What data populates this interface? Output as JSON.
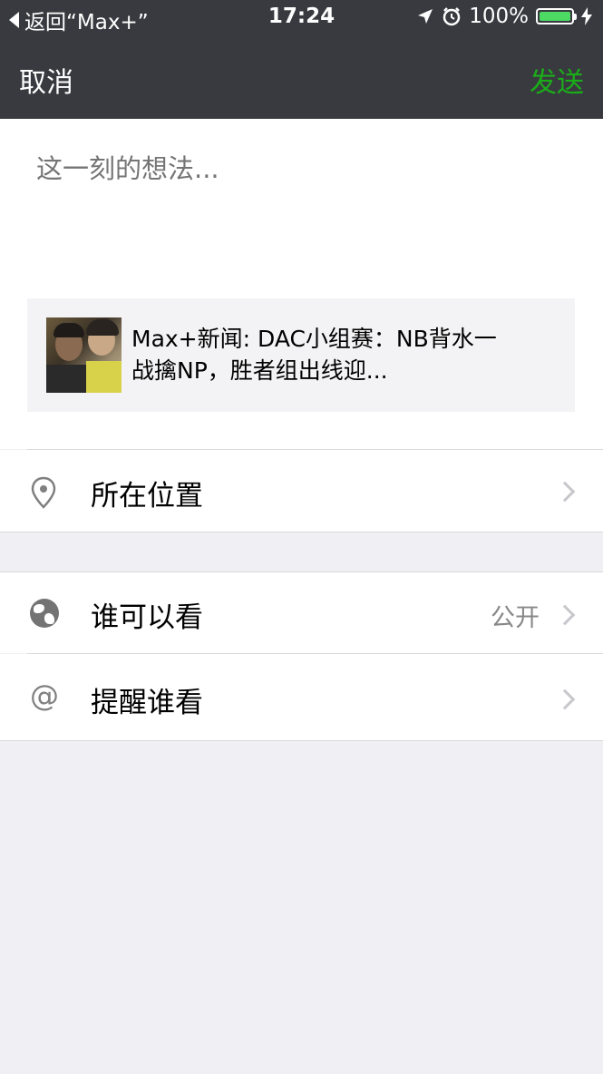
{
  "status_bar": {
    "back_label": "返回“Max+”",
    "time": "17:24",
    "battery": "100%"
  },
  "nav": {
    "cancel": "取消",
    "send": "发送"
  },
  "compose": {
    "placeholder": "这一刻的想法...",
    "link_card_title": "Max+新闻: DAC小组赛：NB背水一战擒NP，胜者组出线迎..."
  },
  "options": {
    "location": {
      "label": "所在位置",
      "icon": "location-pin-icon"
    },
    "visibility": {
      "label": "谁可以看",
      "value": "公开",
      "icon": "globe-icon"
    },
    "mention": {
      "label": "提醒谁看",
      "icon": "at-icon"
    }
  },
  "colors": {
    "header_bg": "#393a3f",
    "send_green": "#1aad19",
    "page_bg": "#efeff4"
  }
}
